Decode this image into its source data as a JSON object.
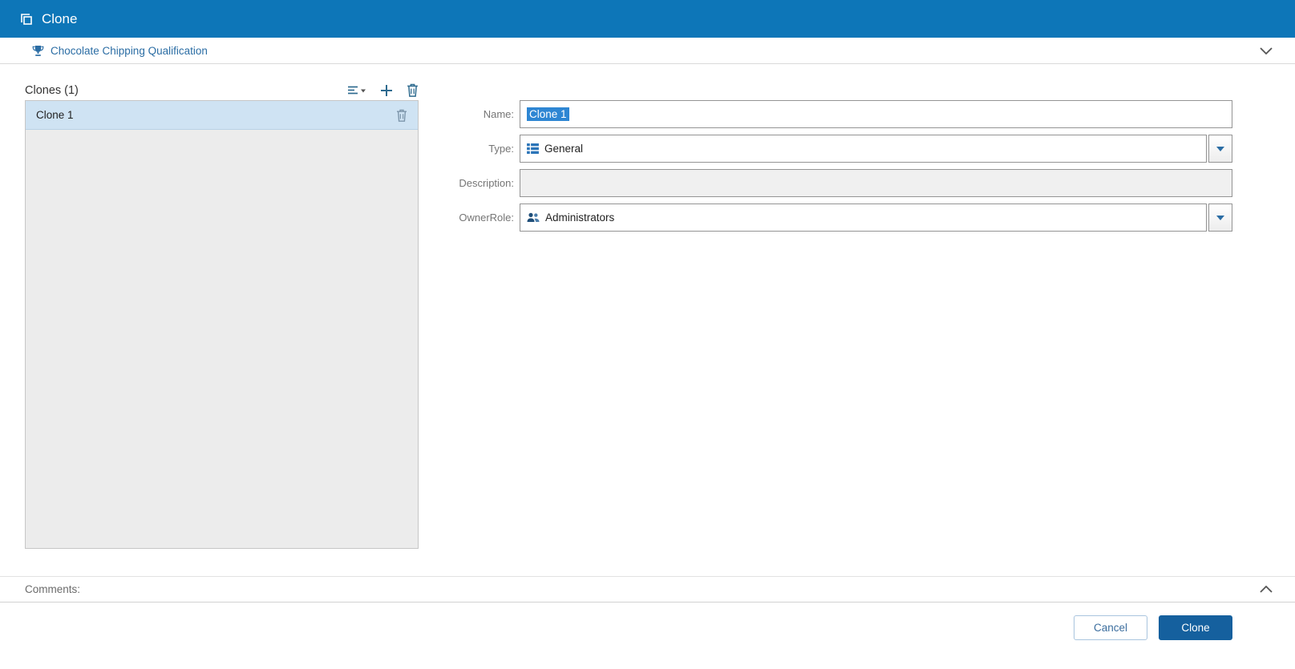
{
  "titlebar": {
    "title": "Clone"
  },
  "context": {
    "item": "Chocolate Chipping Qualification"
  },
  "clones_panel": {
    "header": "Clones (1)",
    "items": [
      {
        "label": "Clone 1"
      }
    ]
  },
  "form": {
    "name": {
      "label": "Name:",
      "value": "Clone 1"
    },
    "type": {
      "label": "Type:",
      "value": "General"
    },
    "description": {
      "label": "Description:",
      "value": ""
    },
    "owner_role": {
      "label": "OwnerRole:",
      "value": "Administrators"
    }
  },
  "comments": {
    "label": "Comments:"
  },
  "footer": {
    "cancel_label": "Cancel",
    "clone_label": "Clone"
  },
  "icons": {
    "titlebar": "clone-icon",
    "context_left": "trophy-icon",
    "context_right": "chevron-down-icon",
    "list_tools": [
      "sort-icon",
      "plus-icon",
      "trash-icon"
    ],
    "list_row": "trash-icon",
    "type_field": "type-grid-icon",
    "owner_role_field": "people-icon",
    "dropdowns": "dropdown-arrow-icon",
    "comments_right": "chevron-up-icon"
  },
  "colors": {
    "header_bg": "#0d76b8",
    "accent_blue": "#2b6da4",
    "icon_blue": "#2e6b8f",
    "list_selection": "#cfe3f3",
    "text_selection": "#2e86d3",
    "primary_button": "#15609e"
  }
}
